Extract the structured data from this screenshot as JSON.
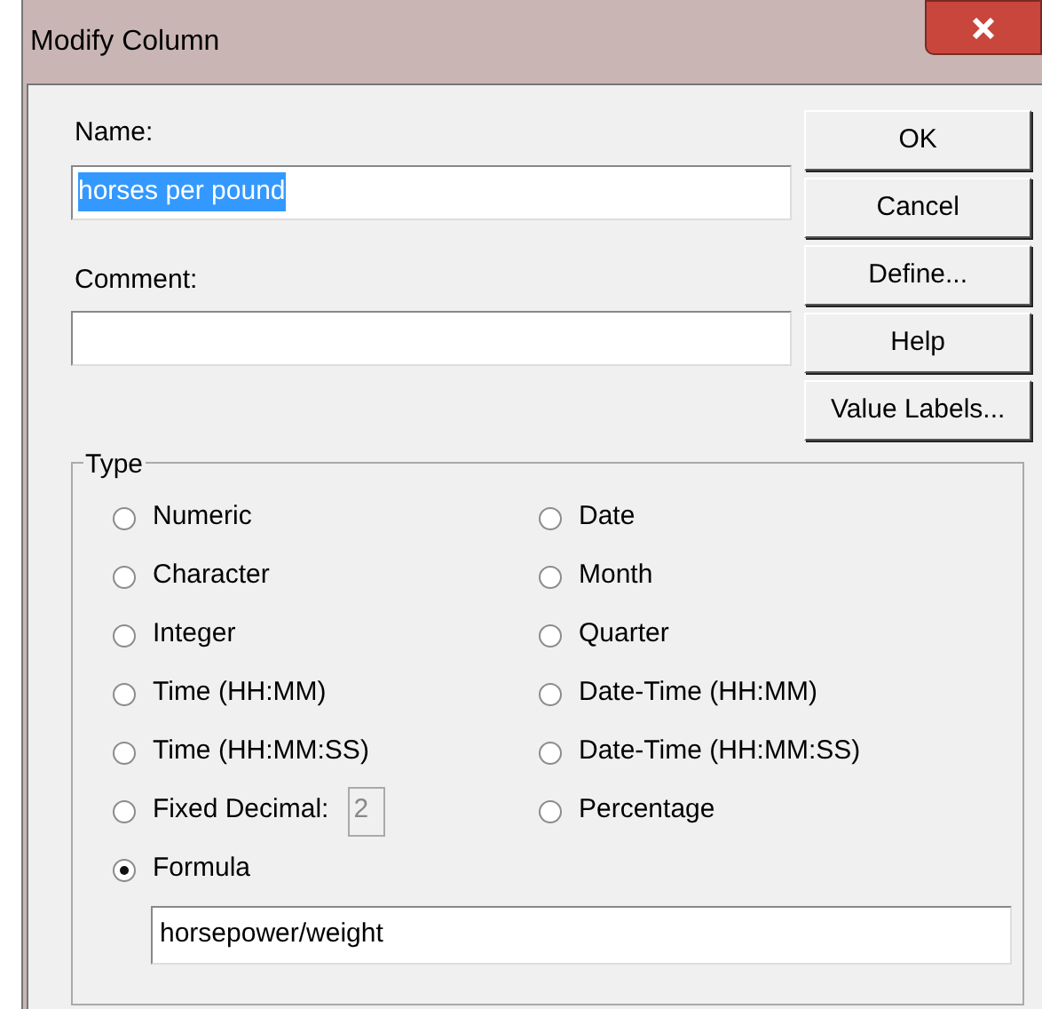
{
  "window": {
    "title": "Modify Column"
  },
  "name_field": {
    "label": "Name:",
    "value": "horses per pound",
    "selected": true
  },
  "comment_field": {
    "label": "Comment:"
  },
  "buttons": [
    "OK",
    "Cancel",
    "Define...",
    "Help",
    "Value Labels..."
  ],
  "type_group": {
    "label": "Type",
    "options": [
      {
        "label": "Numeric",
        "selected": false
      },
      {
        "label": "Date",
        "selected": false
      },
      {
        "label": "Character",
        "selected": false
      },
      {
        "label": "Month",
        "selected": false
      },
      {
        "label": "Integer",
        "selected": false
      },
      {
        "label": "Quarter",
        "selected": false
      },
      {
        "label": "Time (HH:MM)",
        "selected": false
      },
      {
        "label": "Date-Time (HH:MM)",
        "selected": false
      },
      {
        "label": "Time (HH:MM:SS)",
        "selected": false
      },
      {
        "label": "Date-Time (HH:MM:SS)",
        "selected": false
      },
      {
        "label": "Fixed Decimal:",
        "selected": false,
        "digits": {
          "value": "2",
          "disabled": true
        }
      },
      {
        "label": "Percentage",
        "selected": false
      },
      {
        "label": "Formula",
        "selected": true
      }
    ],
    "formula": {
      "value": "horsepower/weight"
    }
  }
}
